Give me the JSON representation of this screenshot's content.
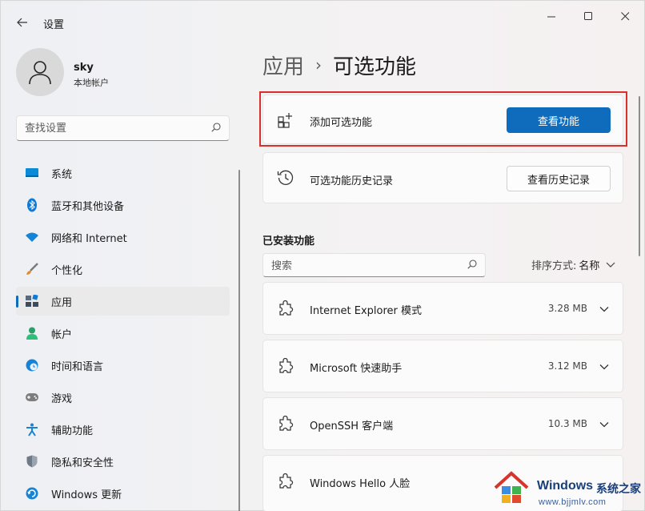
{
  "titlebar": {
    "title": "设置",
    "back_icon": "arrow-left-icon",
    "controls": [
      "minimize-icon",
      "maximize-icon",
      "close-icon"
    ]
  },
  "user": {
    "name": "sky",
    "account_type": "本地帐户"
  },
  "sidebar": {
    "search_placeholder": "查找设置",
    "items": [
      {
        "label": "系统",
        "icon": "system-display-icon",
        "active": false
      },
      {
        "label": "蓝牙和其他设备",
        "icon": "bluetooth-icon",
        "active": false
      },
      {
        "label": "网络和 Internet",
        "icon": "wifi-icon",
        "active": false
      },
      {
        "label": "个性化",
        "icon": "paintbrush-icon",
        "active": false
      },
      {
        "label": "应用",
        "icon": "apps-icon",
        "active": true
      },
      {
        "label": "帐户",
        "icon": "person-icon",
        "active": false
      },
      {
        "label": "时间和语言",
        "icon": "globe-clock-icon",
        "active": false
      },
      {
        "label": "游戏",
        "icon": "gamepad-icon",
        "active": false
      },
      {
        "label": "辅助功能",
        "icon": "accessibility-icon",
        "active": false
      },
      {
        "label": "隐私和安全性",
        "icon": "shield-icon",
        "active": false
      },
      {
        "label": "Windows 更新",
        "icon": "windows-update-icon",
        "active": false
      }
    ]
  },
  "breadcrumb": {
    "parent": "应用",
    "separator": "›",
    "current": "可选功能"
  },
  "add_feature": {
    "label": "添加可选功能",
    "button": "查看功能"
  },
  "history": {
    "label": "可选功能历史记录",
    "button": "查看历史记录"
  },
  "installed": {
    "title": "已安装功能",
    "search_placeholder": "搜索",
    "sort_label": "排序方式:",
    "sort_value": "名称",
    "features": [
      {
        "name": "Internet Explorer 模式",
        "size": "3.28 MB"
      },
      {
        "name": "Microsoft 快速助手",
        "size": "3.12 MB"
      },
      {
        "name": "OpenSSH 客户端",
        "size": "10.3 MB"
      },
      {
        "name": "Windows Hello 人脸",
        "size": ""
      }
    ]
  },
  "watermark": {
    "title": "Windows",
    "subtitle": "系统之家",
    "url": "www.bjjmlv.com"
  },
  "colors": {
    "accent": "#0f6cbd",
    "highlight_border": "#d9302e"
  }
}
